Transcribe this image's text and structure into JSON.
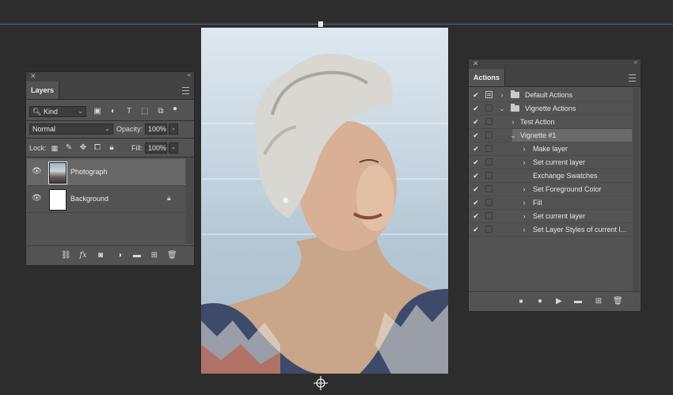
{
  "colors": {
    "canvas_bg": "#2d2d2d",
    "panel_bg": "#535353",
    "selected_row": "#676767",
    "guide": "#4a6aa0"
  },
  "layers_panel": {
    "tab": "Layers",
    "filter": {
      "kind_label": "Kind",
      "icons": [
        "image-filter-icon",
        "adjustment-filter-icon",
        "type-filter-icon",
        "shape-filter-icon",
        "smart-object-filter-icon",
        "filter-toggle-icon"
      ]
    },
    "blend_mode": "Normal",
    "opacity_label": "Opacity:",
    "opacity_value": "100%",
    "lock_label": "Lock:",
    "fill_label": "Fill:",
    "fill_value": "100%",
    "layers": [
      {
        "name": "Photograph",
        "selected": true,
        "visible": true
      },
      {
        "name": "Background",
        "selected": false,
        "visible": true,
        "locked": true
      }
    ],
    "footer_icons": [
      "link-icon",
      "fx-icon",
      "mask-icon",
      "adjustment-icon",
      "group-folder-icon",
      "new-layer-icon",
      "trash-icon"
    ],
    "fx_label": "fx"
  },
  "actions_panel": {
    "tab": "Actions",
    "rows": [
      {
        "name": "Default Actions",
        "checked": true,
        "dialog": true,
        "expanded": false,
        "kind": "set"
      },
      {
        "name": "Vignette Actions",
        "checked": true,
        "dialog": false,
        "expanded": true,
        "kind": "set"
      },
      {
        "name": "Test Action",
        "checked": true,
        "expanded": false,
        "kind": "action"
      },
      {
        "name": "Vignette #1",
        "checked": true,
        "expanded": true,
        "kind": "action",
        "selected": true
      },
      {
        "name": "Make layer",
        "checked": true,
        "expanded": false,
        "kind": "step"
      },
      {
        "name": "Set current layer",
        "checked": true,
        "expanded": false,
        "kind": "step"
      },
      {
        "name": "Exchange Swatches",
        "checked": true,
        "kind": "step-noexpand"
      },
      {
        "name": "Set Foreground Color",
        "checked": true,
        "expanded": false,
        "kind": "step"
      },
      {
        "name": "Fill",
        "checked": true,
        "expanded": false,
        "kind": "step"
      },
      {
        "name": "Set current layer",
        "checked": true,
        "expanded": false,
        "kind": "step"
      },
      {
        "name": "Set Layer Styles of current l...",
        "checked": true,
        "expanded": false,
        "kind": "step"
      }
    ],
    "footer_icons": [
      "stop-icon",
      "record-icon",
      "play-icon",
      "new-set-folder-icon",
      "new-action-icon",
      "trash-icon"
    ]
  }
}
